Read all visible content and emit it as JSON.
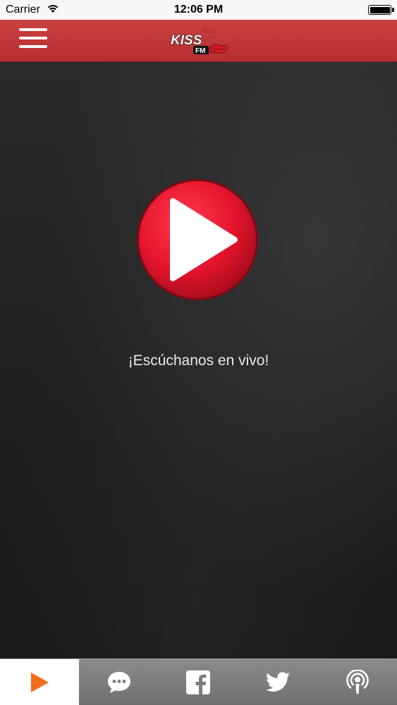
{
  "status_bar": {
    "carrier": "Carrier",
    "time": "12:06 PM",
    "wifi_icon": "wifi-icon",
    "battery_icon": "battery-icon"
  },
  "nav_bar": {
    "menu_icon": "hamburger-menu-icon",
    "logo_text_top": "97.7",
    "logo_text_main": "KISS",
    "logo_text_sub": "FM",
    "background_color": "#c03a3a"
  },
  "main": {
    "play_icon": "play-icon",
    "play_color": "#e4142c",
    "listen_label": "¡Escúchanos en vivo!"
  },
  "tab_bar": {
    "tabs": [
      {
        "icon": "play-icon",
        "active": true,
        "color": "#f26a1b"
      },
      {
        "icon": "chat-bubble-icon",
        "active": false
      },
      {
        "icon": "facebook-icon",
        "active": false
      },
      {
        "icon": "twitter-icon",
        "active": false
      },
      {
        "icon": "podcast-icon",
        "active": false
      }
    ]
  }
}
